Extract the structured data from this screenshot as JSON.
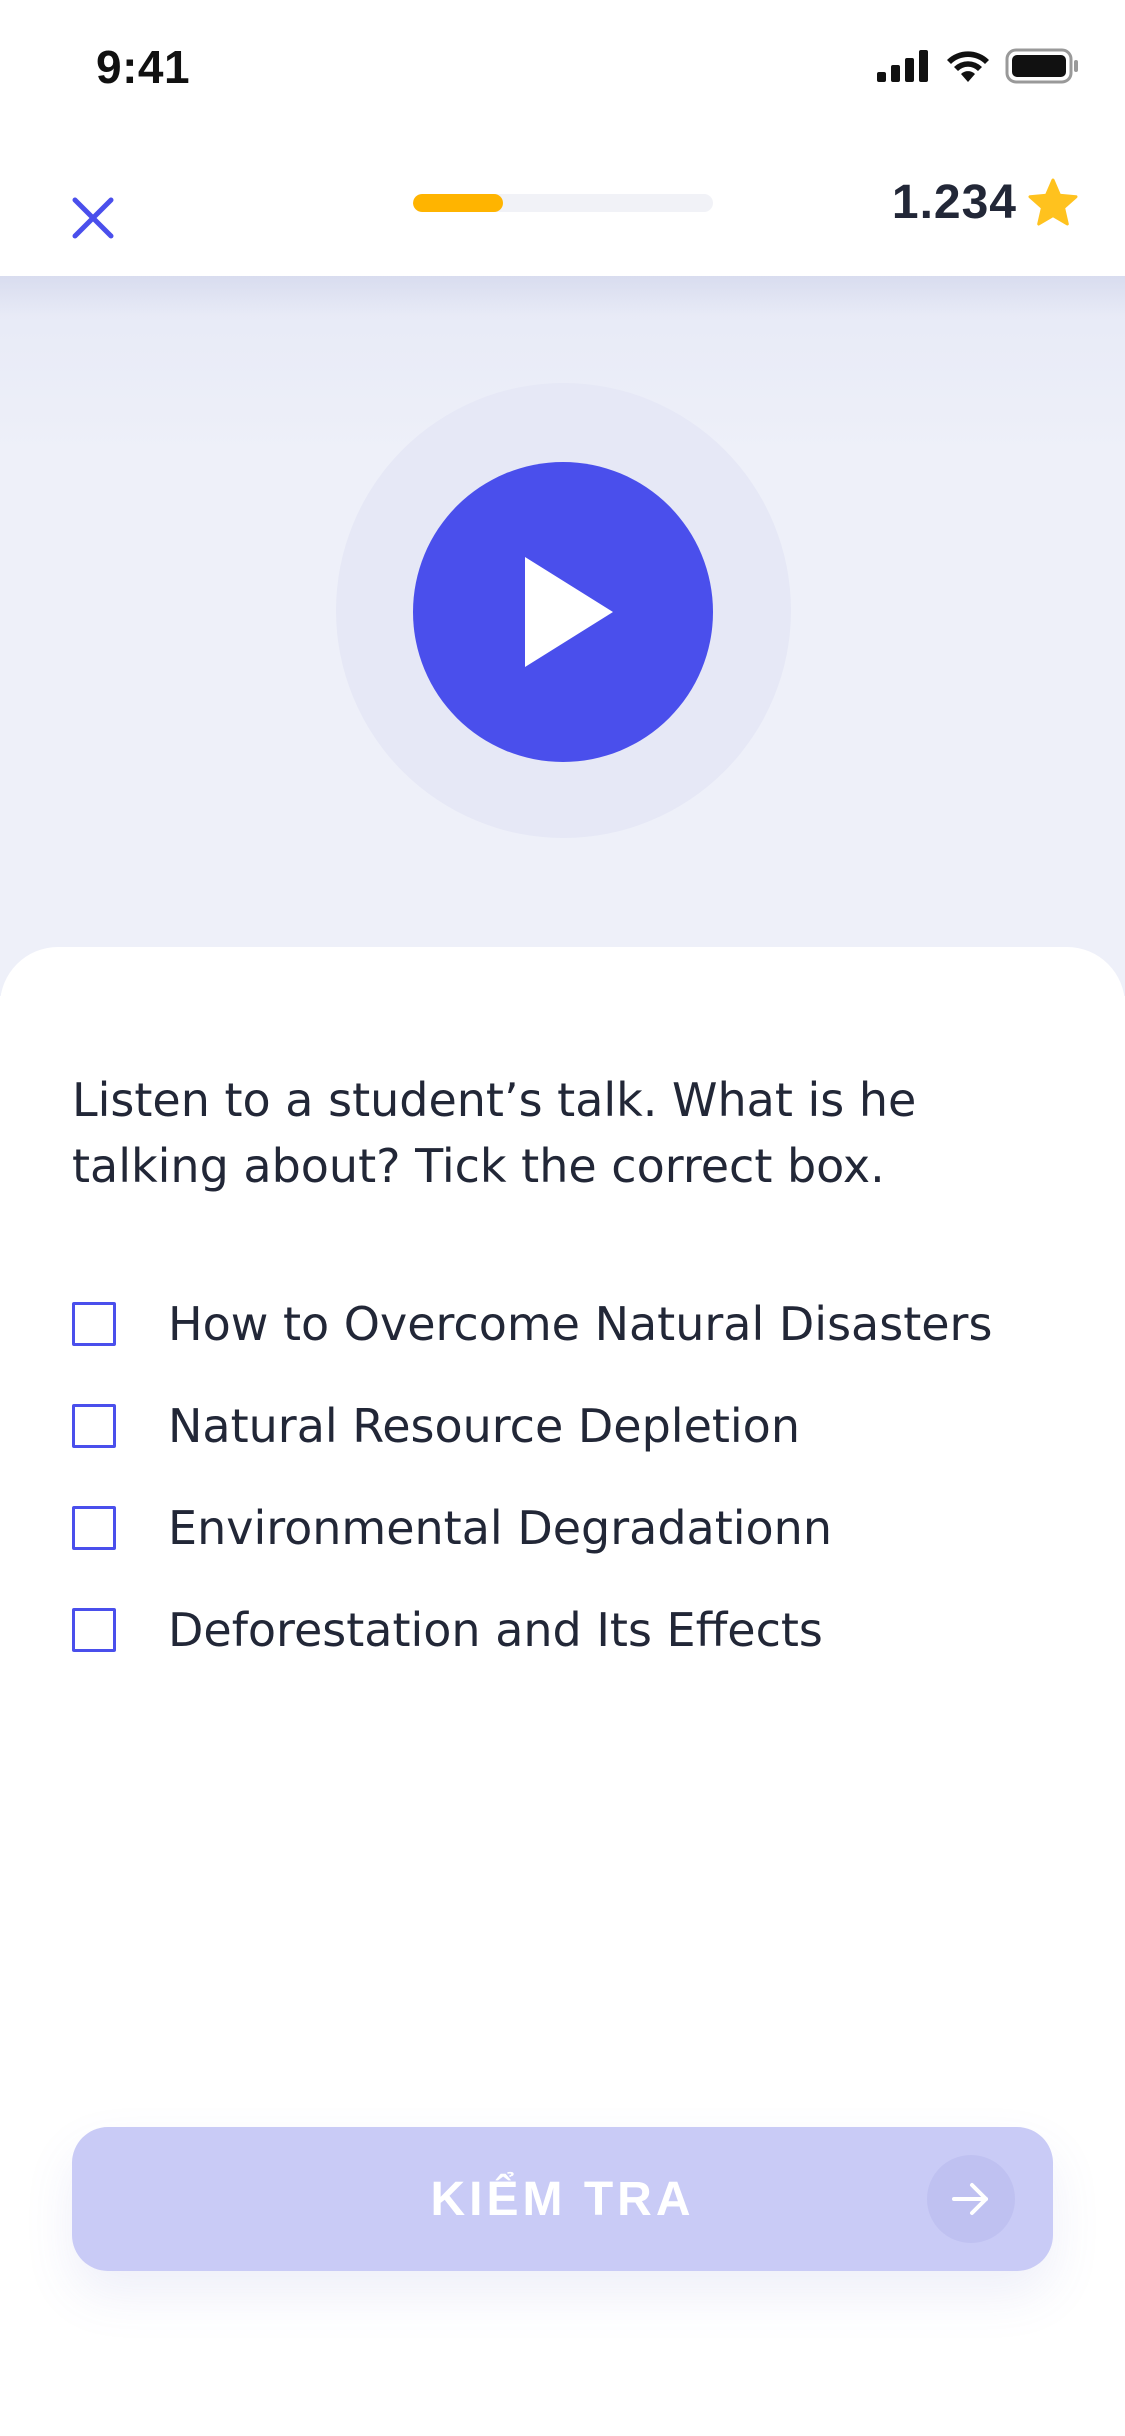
{
  "status_bar": {
    "time": "9:41",
    "icons": [
      "cellular-signal-icon",
      "wifi-icon",
      "battery-icon"
    ]
  },
  "header": {
    "close_icon": "close-icon",
    "progress": 0.3,
    "score": "1.234",
    "score_icon": "star-icon"
  },
  "audio": {
    "play_icon": "play-icon"
  },
  "question": {
    "prompt_line1": "Listen to a student’s talk. What is he",
    "prompt_line2": "talking about? Tick the correct box.",
    "options": [
      {
        "label": "How to Overcome Natural Disasters",
        "checked": false
      },
      {
        "label": "Natural Resource Depletion",
        "checked": false
      },
      {
        "label": "Environmental Degradationn",
        "checked": false
      },
      {
        "label": "Deforestation and Its Effects",
        "checked": false
      }
    ]
  },
  "check_button": {
    "label": "KIỂM TRA",
    "icon": "arrow-right-icon",
    "enabled": false
  },
  "colors": {
    "accent": "#4A4FEC",
    "progress": "#FFB400",
    "star": "#FFC21E",
    "text": "#222737",
    "button_disabled": "#C9CBF6"
  }
}
